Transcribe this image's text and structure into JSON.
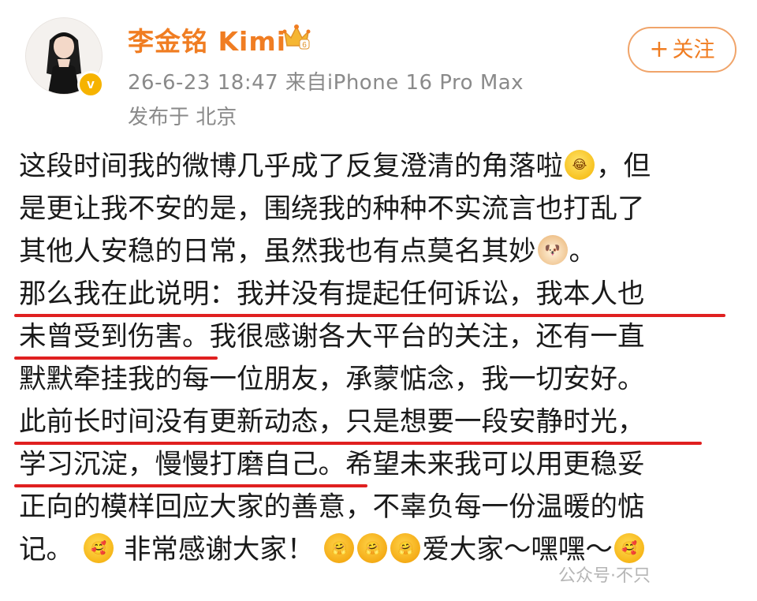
{
  "user": {
    "name": "李金铭 Kimi",
    "verified_badge": "v",
    "crown_icon": "crown-icon"
  },
  "post_meta": {
    "time_source": "26-6-23 18:47  来自iPhone 16 Pro Max",
    "location": "发布于 北京"
  },
  "actions": {
    "follow_plus": "+",
    "follow_label": "关注"
  },
  "post": {
    "lines": [
      "这段时间我的微博几乎成了反复澄清的角落啦",
      "，但",
      "是更让我不安的是，围绕我的种种不实流言也打乱了",
      "其他人安稳的日常，虽然我也有点莫名其妙",
      "。",
      "那么我在此说明：我并没有提起任何诉讼，我本人也",
      "未曾受到伤害。",
      "我很感谢各大平台的关注，还有一直",
      "默默牵挂我的每一位朋友，承蒙惦念，我一切安好。",
      "此前长时间没有更新动态，只是想要一段安静时光，",
      "学习沉淀，慢慢打磨自己。",
      "希望未来我可以用更稳妥",
      "正向的模样回应大家的善意，不辜负每一份温暖的惦",
      "记。",
      "非常感谢大家！",
      "爱大家～嘿嘿～"
    ]
  },
  "watermark": "公众号·不只",
  "colors": {
    "name": "#f07d22",
    "meta": "#8a8a8a",
    "underline": "#e02020",
    "follow_border": "#f0a46a"
  }
}
